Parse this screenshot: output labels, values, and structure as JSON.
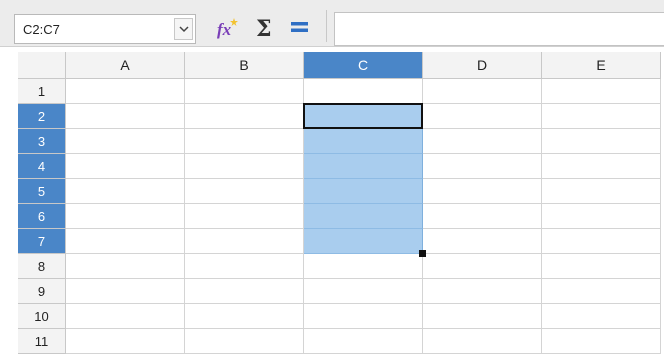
{
  "formula_bar": {
    "name_box_value": "C2:C7",
    "buttons": [
      {
        "icon": "function-wizard-icon",
        "label": "fx"
      },
      {
        "icon": "sum-icon",
        "label": "Σ"
      },
      {
        "icon": "equals-icon",
        "label": "="
      }
    ],
    "input_value": ""
  },
  "sheet": {
    "columns": [
      "A",
      "B",
      "C",
      "D",
      "E"
    ],
    "rows": [
      "1",
      "2",
      "3",
      "4",
      "5",
      "6",
      "7",
      "8",
      "9",
      "10",
      "11"
    ],
    "selected_column": "C",
    "selected_rows": [
      "2",
      "3",
      "4",
      "5",
      "6",
      "7"
    ],
    "selection_range": "C2:C7",
    "active_cell": "C2"
  },
  "colors": {
    "header_selected": "#4a86c8",
    "cell_selected": "#a9cdee"
  }
}
